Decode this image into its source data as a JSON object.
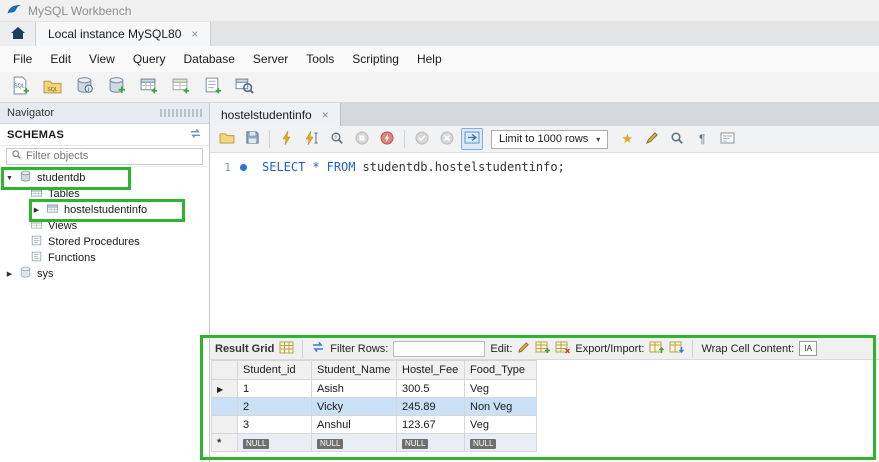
{
  "window": {
    "title": "MySQL Workbench"
  },
  "connection_tab": {
    "label": "Local instance MySQL80",
    "close": "×"
  },
  "menu": {
    "items": [
      "File",
      "Edit",
      "View",
      "Query",
      "Database",
      "Server",
      "Tools",
      "Scripting",
      "Help"
    ]
  },
  "navigator": {
    "title": "Navigator",
    "schemas_label": "SCHEMAS",
    "filter_placeholder": "Filter objects",
    "tree": {
      "studentdb": "studentdb",
      "tables": "Tables",
      "hostelstudentinfo": "hostelstudentinfo",
      "views": "Views",
      "stored_procedures": "Stored Procedures",
      "functions": "Functions",
      "sys": "sys"
    },
    "expanders": {
      "down": "▼",
      "right": "▶"
    }
  },
  "editor": {
    "tab_label": "hostelstudentinfo",
    "tab_close": "×",
    "limit_dropdown": "Limit to 1000 rows",
    "dropdown_caret": "▾",
    "line_number": "1",
    "sql": {
      "select": "SELECT",
      "star": "*",
      "from": "FROM",
      "rest": "studentdb.hostelstudentinfo;"
    }
  },
  "result": {
    "grid_label": "Result Grid",
    "filter_rows_label": "Filter Rows:",
    "edit_label": "Edit:",
    "export_import_label": "Export/Import:",
    "wrap_cell_label": "Wrap Cell Content:",
    "wrap_icon_text": "IA",
    "columns": [
      "Student_id",
      "Student_Name",
      "Hostel_Fee",
      "Food_Type"
    ],
    "rows": [
      {
        "cells": [
          "1",
          "Asish",
          "300.5",
          "Veg"
        ]
      },
      {
        "cells": [
          "2",
          "Vicky",
          "245.89",
          "Non Veg"
        ]
      },
      {
        "cells": [
          "3",
          "Anshul",
          "123.67",
          "Veg"
        ]
      }
    ],
    "null_text": "NULL",
    "new_row_marker": "*",
    "current_row_marker": "▶"
  },
  "colors": {
    "annotation_green": "#2db52d",
    "keyword_blue": "#2060d0",
    "selected_row": "#c9e0f7"
  }
}
